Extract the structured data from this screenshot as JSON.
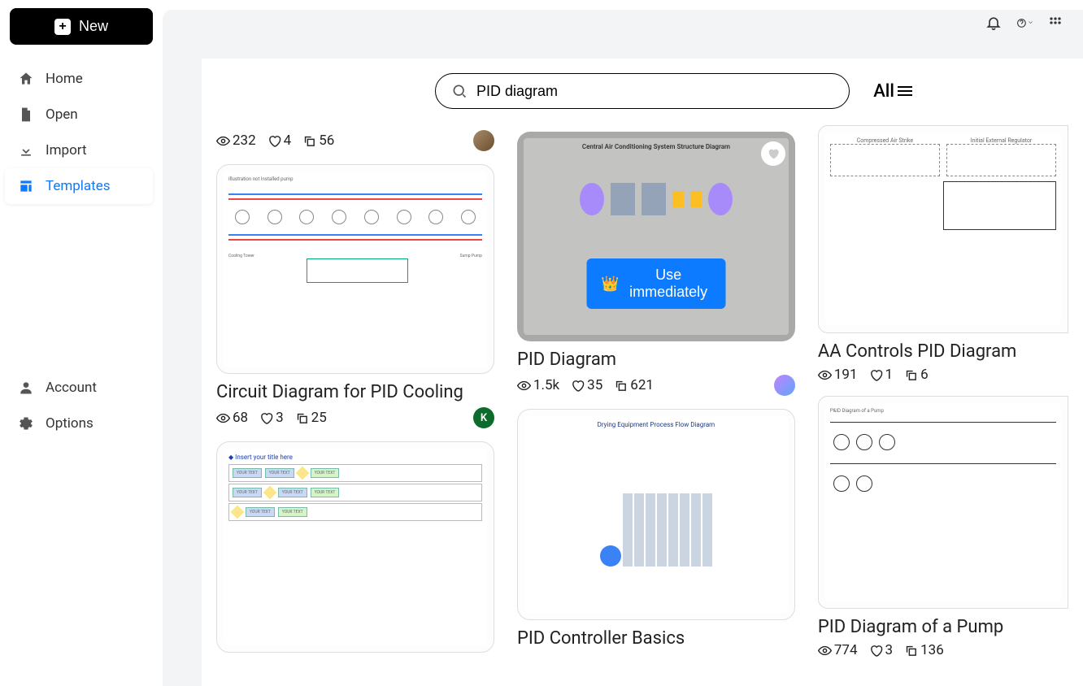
{
  "sidebar": {
    "new_label": "New",
    "items": [
      {
        "label": "Home"
      },
      {
        "label": "Open"
      },
      {
        "label": "Import"
      },
      {
        "label": "Templates"
      }
    ],
    "bottom": [
      {
        "label": "Account"
      },
      {
        "label": "Options"
      }
    ]
  },
  "search": {
    "value": "PID diagram"
  },
  "filter": {
    "label": "All"
  },
  "use_immediately_label": "Use immediately",
  "templates": {
    "col1_top_stats": {
      "views": "232",
      "likes": "4",
      "copies": "56"
    },
    "circuit": {
      "title": "Circuit Diagram for PID Cooling",
      "views": "68",
      "likes": "3",
      "copies": "25",
      "avatar_letter": "K",
      "thumb_note": "Illustration not Installed pump",
      "thumb_bottom_left": "Cooling Tower",
      "thumb_bottom_right": "Sump Pump"
    },
    "flowchart": {
      "thumb_title": "Insert your title here"
    },
    "pid": {
      "title": "PID Diagram",
      "views": "1.5k",
      "likes": "35",
      "copies": "621",
      "thumb_title": "Central Air Conditioning System Structure Diagram"
    },
    "controller": {
      "title": "PID Controller Basics",
      "thumb_title": "Drying Equipment Process Flow Diagram"
    },
    "aa": {
      "title": "AA Controls PID Diagram",
      "views": "191",
      "likes": "1",
      "copies": "6",
      "thumb_label1": "Compressed Air Strike",
      "thumb_label2": "Initial External Regulator"
    },
    "pump": {
      "title": "PID Diagram of a Pump",
      "views": "774",
      "likes": "3",
      "copies": "136",
      "thumb_title": "P&ID Diagram of a Pump"
    }
  }
}
